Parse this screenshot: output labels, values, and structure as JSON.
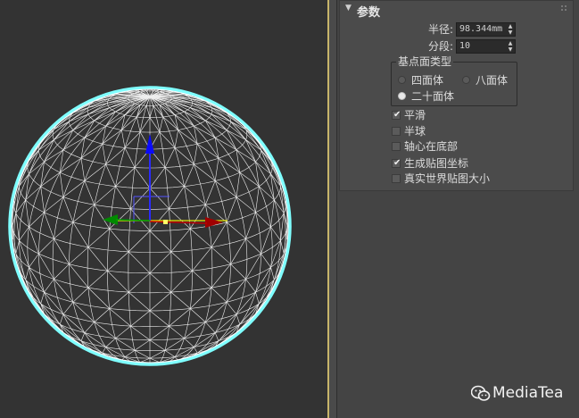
{
  "rollout": {
    "title": "参数",
    "radius_label": "半径:",
    "radius_value": "98.344mm",
    "segments_label": "分段:",
    "segments_value": "10"
  },
  "base_type": {
    "title": "基点面类型",
    "options": [
      "四面体",
      "八面体",
      "二十面体"
    ],
    "selected": "二十面体"
  },
  "options": [
    {
      "label": "平滑",
      "checked": true
    },
    {
      "label": "半球",
      "checked": false
    },
    {
      "label": "轴心在底部",
      "checked": false
    },
    {
      "label": "生成贴图坐标",
      "checked": true
    },
    {
      "label": "真实世界贴图大小",
      "checked": false
    }
  ],
  "watermark": {
    "text": "MediaTea"
  },
  "colors": {
    "viewport_bg": "#333333",
    "wireframe": "#ffffff",
    "silhouette": "#00ffff",
    "frame_border": "#c8b56a",
    "panel_bg": "#444444",
    "axis_x": "#c00000",
    "axis_y": "#00a000",
    "axis_z": "#0000ff",
    "pivot_line": "#ffff00"
  }
}
